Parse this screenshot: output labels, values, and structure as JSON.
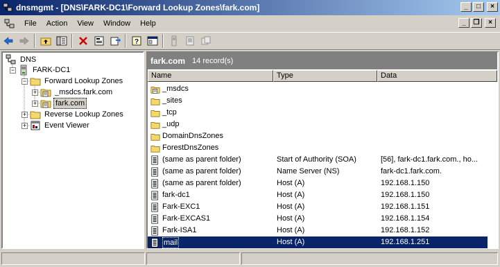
{
  "window": {
    "title": "dnsmgmt - [DNS\\FARK-DC1\\Forward Lookup Zones\\fark.com]",
    "buttons": {
      "minimize": "_",
      "maximize": "□",
      "close": "×"
    }
  },
  "menu": {
    "items": [
      {
        "label": "File"
      },
      {
        "label": "Action"
      },
      {
        "label": "View"
      },
      {
        "label": "Window"
      },
      {
        "label": "Help"
      }
    ],
    "child_buttons": {
      "minimize": "_",
      "restore": "❐",
      "close": "×"
    }
  },
  "toolbar": {
    "icons": [
      "back-icon",
      "forward-icon",
      "up-folder-icon",
      "show-hide-tree-icon",
      "delete-icon",
      "properties-icon",
      "export-icon",
      "help-icon",
      "console-icon",
      "record-icon",
      "new-record-icon",
      "new-zone-icon"
    ]
  },
  "tree": {
    "nodes": [
      {
        "label": "DNS",
        "icon": "dns-icon"
      },
      {
        "label": "FARK-DC1",
        "icon": "server-icon"
      },
      {
        "label": "Forward Lookup Zones",
        "icon": "folder-icon"
      },
      {
        "label": "_msdcs.fark.com",
        "icon": "zone-icon"
      },
      {
        "label": "fark.com",
        "icon": "zone-icon"
      },
      {
        "label": "Reverse Lookup Zones",
        "icon": "folder-icon"
      },
      {
        "label": "Event Viewer",
        "icon": "event-viewer-icon"
      }
    ]
  },
  "zone": {
    "name": "fark.com",
    "record_count": "14 record(s)"
  },
  "columns": {
    "name": "Name",
    "type": "Type",
    "data": "Data"
  },
  "records": [
    {
      "name": "_msdcs",
      "type": "",
      "data": "",
      "icon": "zone-folder-icon"
    },
    {
      "name": "_sites",
      "type": "",
      "data": "",
      "icon": "folder-icon"
    },
    {
      "name": "_tcp",
      "type": "",
      "data": "",
      "icon": "folder-icon"
    },
    {
      "name": "_udp",
      "type": "",
      "data": "",
      "icon": "folder-icon"
    },
    {
      "name": "DomainDnsZones",
      "type": "",
      "data": "",
      "icon": "folder-icon"
    },
    {
      "name": "ForestDnsZones",
      "type": "",
      "data": "",
      "icon": "folder-icon"
    },
    {
      "name": "(same as parent folder)",
      "type": "Start of Authority (SOA)",
      "data": "[56], fark-dc1.fark.com., ho...",
      "icon": "record-icon"
    },
    {
      "name": "(same as parent folder)",
      "type": "Name Server (NS)",
      "data": "fark-dc1.fark.com.",
      "icon": "record-icon"
    },
    {
      "name": "(same as parent folder)",
      "type": "Host (A)",
      "data": "192.168.1.150",
      "icon": "record-icon"
    },
    {
      "name": "fark-dc1",
      "type": "Host (A)",
      "data": "192.168.1.150",
      "icon": "record-icon"
    },
    {
      "name": "Fark-EXC1",
      "type": "Host (A)",
      "data": "192.168.1.151",
      "icon": "record-icon"
    },
    {
      "name": "Fark-EXCAS1",
      "type": "Host (A)",
      "data": "192.168.1.154",
      "icon": "record-icon"
    },
    {
      "name": "Fark-ISA1",
      "type": "Host (A)",
      "data": "192.168.1.152",
      "icon": "record-icon"
    },
    {
      "name": "mail",
      "type": "Host (A)",
      "data": "192.168.1.251",
      "icon": "record-icon",
      "selected": true
    }
  ],
  "colors": {
    "title_gradient_start": "#0a246a",
    "title_gradient_end": "#a6caf0",
    "selection": "#0a246a",
    "face": "#d4d0c8"
  }
}
